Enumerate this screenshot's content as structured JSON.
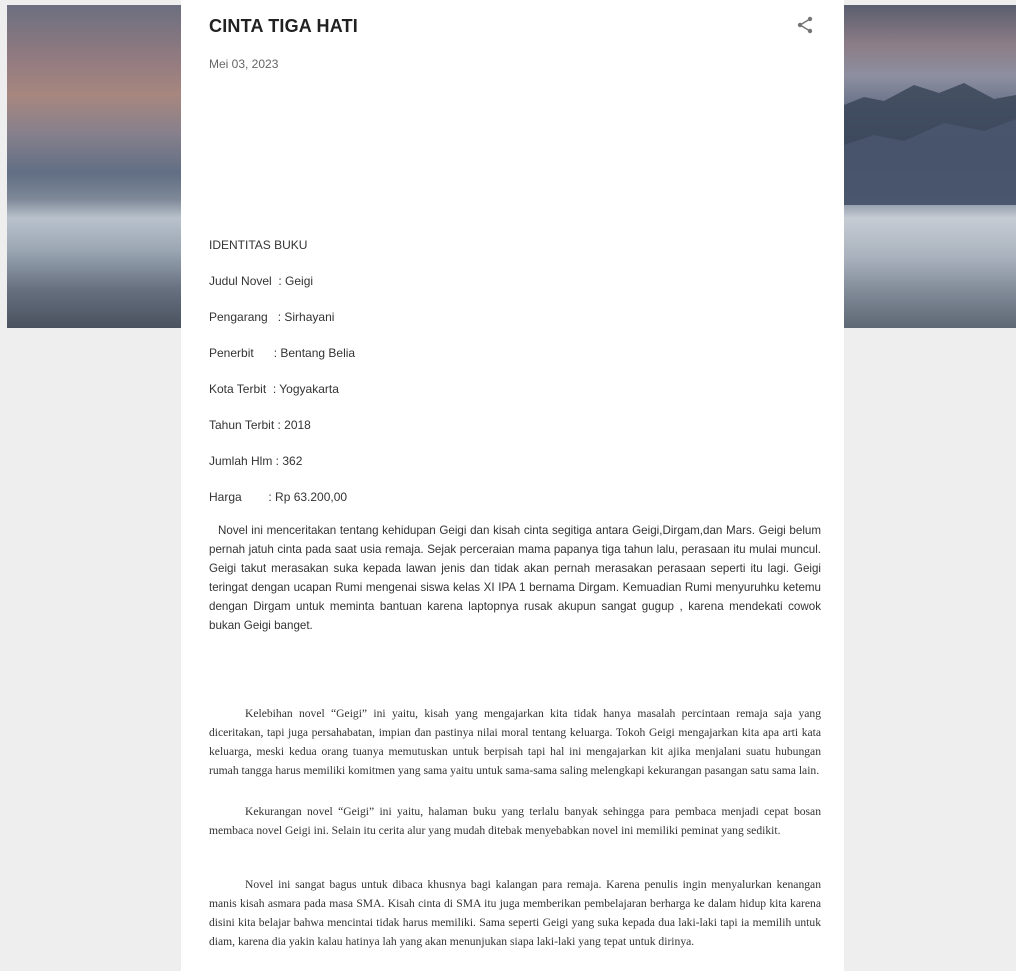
{
  "post": {
    "title": "CINTA TIGA HATI",
    "date": "Mei 03, 2023",
    "icons": {
      "share": "share-icon"
    }
  },
  "identity": {
    "heading": "IDENTITAS BUKU",
    "items": [
      "Judul Novel  : Geigi",
      "Pengarang   : Sirhayani",
      "Penerbit      : Bentang Belia",
      "Kota Terbit  : Yogyakarta",
      "Tahun Terbit : 2018",
      "Jumlah Hlm : 362",
      "Harga        : Rp 63.200,00"
    ]
  },
  "body": {
    "synopsis": "Novel ini menceritakan tentang kehidupan Geigi dan kisah cinta segitiga antara Geigi,Dirgam,dan Mars. Geigi belum pernah jatuh cinta pada saat usia remaja. Sejak perceraian mama papanya tiga tahun lalu, perasaan itu mulai muncul. Geigi takut merasakan suka kepada lawan jenis dan tidak akan pernah merasakan perasaan seperti itu lagi. Geigi teringat dengan ucapan Rumi mengenai siswa kelas XI IPA 1 bernama Dirgam. Kemuadian Rumi menyuruhku ketemu dengan Dirgam untuk meminta bantuan karena laptopnya rusak akupun sangat gugup , karena mendekati cowok bukan Geigi banget.",
    "strengths": "Kelebihan novel “Geigi” ini yaitu, kisah yang mengajarkan kita tidak hanya masalah percintaan remaja saja yang diceritakan, tapi juga persahabatan, impian dan pastinya nilai moral tentang keluarga.  Tokoh Geigi mengajarkan kita apa arti kata keluarga, meski kedua orang tuanya memutuskan untuk berpisah tapi hal ini mengajarkan kit ajika menjalani suatu hubungan rumah tangga harus memiliki komitmen yang sama yaitu untuk sama-sama saling melengkapi kekurangan pasangan satu sama lain.",
    "weaknesses": "Kekurangan novel “Geigi” ini yaitu, halaman buku yang terlalu banyak sehingga para pembaca menjadi cepat bosan membaca novel Geigi ini. Selain itu cerita alur yang mudah ditebak menyebabkan novel ini memiliki peminat yang sedikit.",
    "conclusion": "Novel ini sangat bagus untuk dibaca khusnya bagi kalangan para remaja. Karena penulis ingin menyalurkan kenangan manis kisah asmara pada masa SMA. Kisah cinta di SMA itu juga memberikan pembelajaran berharga ke dalam hidup kita karena disini kita belajar bahwa mencintai tidak harus memiliki. Sama seperti Geigi yang suka kepada dua laki-laki tapi ia memilih untuk diam, karena dia yakin kalau hatinya lah yang akan menunjukan siapa laki-laki yang tepat untuk dirinya."
  }
}
